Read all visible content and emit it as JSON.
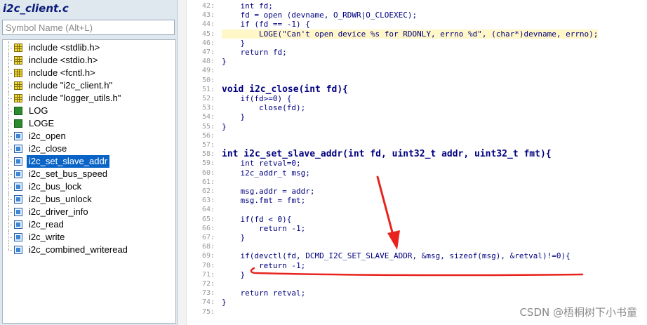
{
  "sidebar": {
    "file_title": "i2c_client.c",
    "search_placeholder": "Symbol Name (Alt+L)",
    "symbols": [
      {
        "label": "include <stdlib.h>",
        "kind": "include-icon"
      },
      {
        "label": "include <stdio.h>",
        "kind": "include-icon"
      },
      {
        "label": "include <fcntl.h>",
        "kind": "include-icon"
      },
      {
        "label": "include \"i2c_client.h\"",
        "kind": "include-icon"
      },
      {
        "label": "include \"logger_utils.h\"",
        "kind": "include-icon"
      },
      {
        "label": "LOG",
        "kind": "macro-icon"
      },
      {
        "label": "LOGE",
        "kind": "macro-icon"
      },
      {
        "label": "i2c_open",
        "kind": "function-icon"
      },
      {
        "label": "i2c_close",
        "kind": "function-icon"
      },
      {
        "label": "i2c_set_slave_addr",
        "kind": "function-icon",
        "selected": true
      },
      {
        "label": "i2c_set_bus_speed",
        "kind": "function-icon"
      },
      {
        "label": "i2c_bus_lock",
        "kind": "function-icon"
      },
      {
        "label": "i2c_bus_unlock",
        "kind": "function-icon"
      },
      {
        "label": "i2c_driver_info",
        "kind": "function-icon"
      },
      {
        "label": "i2c_read",
        "kind": "function-icon"
      },
      {
        "label": "i2c_write",
        "kind": "function-icon"
      },
      {
        "label": "i2c_combined_writeread",
        "kind": "function-icon"
      }
    ]
  },
  "editor": {
    "lines": [
      {
        "n": "42:",
        "t": "    int fd;"
      },
      {
        "n": "43:",
        "t": "    fd = open (devname, O_RDWR|O_CLOEXEC);"
      },
      {
        "n": "44:",
        "t": "    if (fd == -1) {"
      },
      {
        "n": "45:",
        "t": "        LOGE(\"Can't open device %s for RDONLY, errno %d\", (char*)devname, errno);"
      },
      {
        "n": "46:",
        "t": "    }"
      },
      {
        "n": "47:",
        "t": "    return fd;"
      },
      {
        "n": "48:",
        "t": "}"
      },
      {
        "n": "49:",
        "t": ""
      },
      {
        "n": "50:",
        "t": ""
      },
      {
        "n": "51:",
        "t": "void i2c_close(int fd){"
      },
      {
        "n": "52:",
        "t": "    if(fd>=0) {"
      },
      {
        "n": "53:",
        "t": "        close(fd);"
      },
      {
        "n": "54:",
        "t": "    }"
      },
      {
        "n": "55:",
        "t": "}"
      },
      {
        "n": "56:",
        "t": ""
      },
      {
        "n": "57:",
        "t": ""
      },
      {
        "n": "58:",
        "t": "int i2c_set_slave_addr(int fd, uint32_t addr, uint32_t fmt){"
      },
      {
        "n": "59:",
        "t": "    int retval=0;"
      },
      {
        "n": "60:",
        "t": "    i2c_addr_t msg;"
      },
      {
        "n": "61:",
        "t": ""
      },
      {
        "n": "62:",
        "t": "    msg.addr = addr;"
      },
      {
        "n": "63:",
        "t": "    msg.fmt = fmt;"
      },
      {
        "n": "64:",
        "t": ""
      },
      {
        "n": "65:",
        "t": "    if(fd < 0){"
      },
      {
        "n": "66:",
        "t": "        return -1;"
      },
      {
        "n": "67:",
        "t": "    }"
      },
      {
        "n": "68:",
        "t": ""
      },
      {
        "n": "69:",
        "t": "    if(devctl(fd, DCMD_I2C_SET_SLAVE_ADDR, &msg, sizeof(msg), &retval)!=0){"
      },
      {
        "n": "70:",
        "t": "        return -1;"
      },
      {
        "n": "71:",
        "t": "    }"
      },
      {
        "n": "72:",
        "t": ""
      },
      {
        "n": "73:",
        "t": "    return retval;"
      },
      {
        "n": "74:",
        "t": "}"
      },
      {
        "n": "75:",
        "t": ""
      }
    ]
  },
  "watermark": "CSDN @梧桐树下小书童",
  "colors": {
    "selection": "#0a64c8",
    "annotation_red": "#e8231d",
    "code_text": "#000080",
    "keyword_red": "#c00000"
  }
}
